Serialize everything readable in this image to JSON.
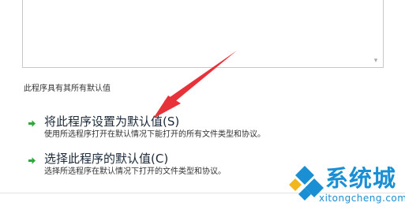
{
  "status_text": "此程序具有其所有默认值",
  "options": [
    {
      "title": "将此程序设置为默认值(S)",
      "description": "使用所选程序打开在默认情况下能打开的所有文件类型和协议。"
    },
    {
      "title": "选择此程序的默认值(C)",
      "description": "选择所选程序在默认情况下打开的文件类型和协议。"
    }
  ],
  "watermark": {
    "name": "系统城",
    "domain": "xitongcheng.com"
  },
  "colors": {
    "arrow_icon": "#2eaa3a",
    "annotation": "#e8323a",
    "watermark": "#1a8fd4"
  }
}
